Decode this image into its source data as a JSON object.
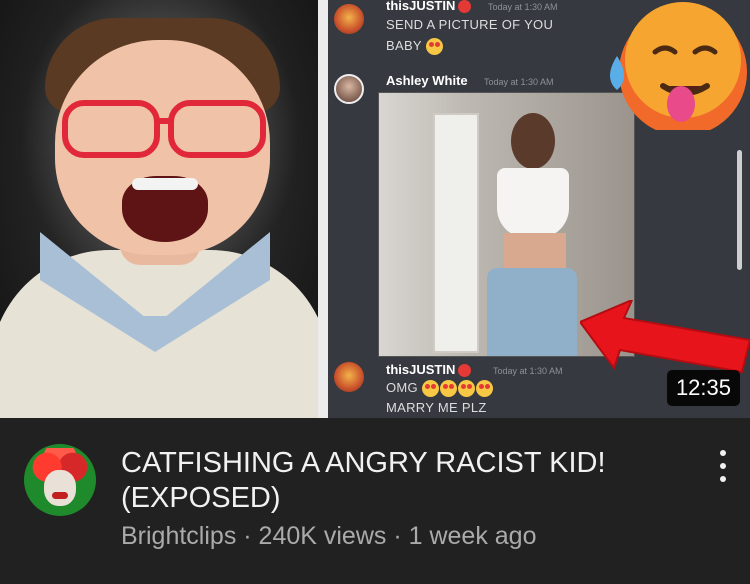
{
  "thumbnail": {
    "duration": "12:35",
    "chat": {
      "msg1": {
        "username": "thisJUSTIN",
        "timestamp": "Today at 1:30 AM",
        "line1": "SEND A PICTURE OF YOU",
        "line2": "BABY"
      },
      "msg2": {
        "username": "Ashley White",
        "timestamp": "Today at 1:30 AM"
      },
      "msg3": {
        "username": "thisJUSTIN",
        "timestamp": "Today at 1:30 AM",
        "line1": "OMG",
        "line2": "MARRY ME PLZ"
      }
    },
    "emoji_name": "hot-face-emoji",
    "arrow_color": "#e8141b"
  },
  "video": {
    "title": "CATFISHING A ANGRY RACIST KID! (EXPOSED)",
    "channel": "Brightclips",
    "views": "240K views",
    "age": "1 week ago",
    "separator": " · "
  },
  "colors": {
    "background": "#212121",
    "title_text": "#f1f1f1",
    "meta_text": "#aaaaaa",
    "chat_bg": "#36393f"
  }
}
